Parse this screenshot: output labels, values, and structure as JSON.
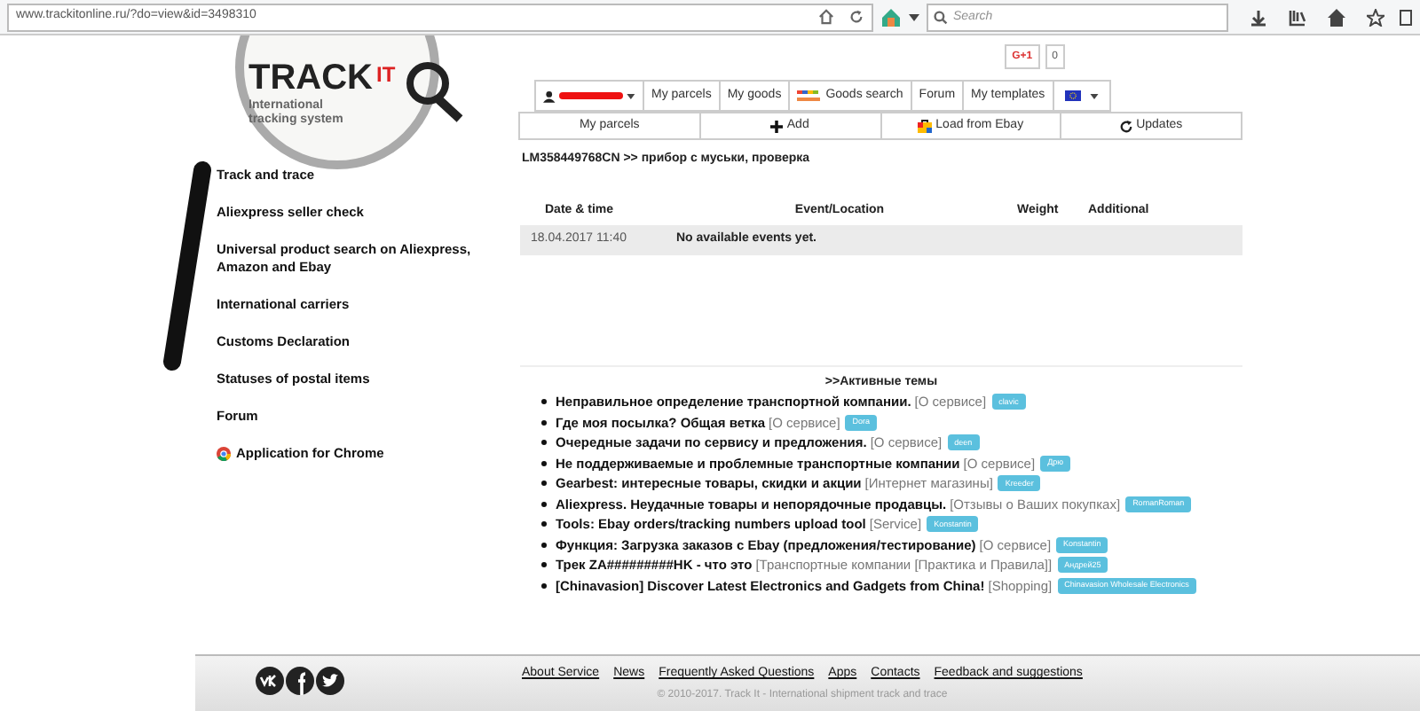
{
  "browser": {
    "url": "www.trackitonline.ru/?do=view&id=3498310",
    "search_placeholder": "Search"
  },
  "logo": {
    "title": "TRACK",
    "badge": "IT",
    "subtitle": "International tracking system"
  },
  "gplus": {
    "label": "G+1",
    "count": "0"
  },
  "nav_tabs": [
    {
      "kind": "user"
    },
    {
      "kind": "text",
      "label": "My parcels"
    },
    {
      "kind": "text",
      "label": "My goods"
    },
    {
      "kind": "shop",
      "label": "Goods search"
    },
    {
      "kind": "text",
      "label": "Forum"
    },
    {
      "kind": "text",
      "label": "My templates"
    },
    {
      "kind": "language"
    }
  ],
  "action_buttons": [
    {
      "kind": "plain",
      "label": "My parcels"
    },
    {
      "kind": "add",
      "label": "Add"
    },
    {
      "kind": "ebay",
      "label": "Load from Ebay"
    },
    {
      "kind": "refresh",
      "label": "Updates"
    }
  ],
  "sidebar": {
    "items": [
      {
        "kind": "text",
        "label": "Track and trace"
      },
      {
        "kind": "text",
        "label": "Aliexpress seller check"
      },
      {
        "kind": "text",
        "label": "Universal product search on Aliexpress, Amazon and Ebay"
      },
      {
        "kind": "text",
        "label": "International carriers"
      },
      {
        "kind": "text",
        "label": "Customs Declaration"
      },
      {
        "kind": "text",
        "label": "Statuses of postal items"
      },
      {
        "kind": "text",
        "label": "Forum"
      },
      {
        "kind": "chrome",
        "label": "Application for Chrome"
      }
    ]
  },
  "parcel_title": "LM358449768CN >> прибор с муськи, проверка",
  "table": {
    "columns": [
      "Date & time",
      "Event/Location",
      "Weight",
      "Additional"
    ],
    "rows": [
      {
        "cells": [
          "18.04.2017 11:40",
          "No available events yet.",
          "",
          ""
        ]
      }
    ]
  },
  "topics": {
    "heading": ">>Активные темы",
    "items": [
      {
        "title": "Неправильное определение транспортной компании.",
        "category": "[О сервисе]",
        "author": "clavic"
      },
      {
        "title": "Где моя посылка? Общая ветка",
        "category": "[О сервисе]",
        "author": "Dora"
      },
      {
        "title": "Очередные задачи по сервису и предложения.",
        "category": "[О сервисе]",
        "author": "deen"
      },
      {
        "title": "Не поддерживаемые и проблемные транспортные компании",
        "category": "[О сервисе]",
        "author": "Дрю"
      },
      {
        "title": "Gearbest: интересные товары, скидки и акции",
        "category": "[Интернет магазины]",
        "author": "Kreeder"
      },
      {
        "title": "Aliexpress. Неудачные товары и непорядочные продавцы.",
        "category": "[Отзывы о Ваших покупках]",
        "author": "RomanRoman"
      },
      {
        "title": "Tools: Ebay orders/tracking numbers upload tool",
        "category": "[Service]",
        "author": "Konstantin"
      },
      {
        "title": "Функция: Загрузка заказов с Ebay (предложения/тестирование)",
        "category": "[О сервисе]",
        "author": "Konstantin"
      },
      {
        "title": "Трек ZA#########HK - что это",
        "category": "[Транспортные компании [Практика и Правила]]",
        "author": "Андрей25"
      },
      {
        "title": "[Chinavasion] Discover Latest Electronics and Gadgets from China!",
        "category": "[Shopping]",
        "author": "Chinavasion Wholesale Electronics"
      }
    ]
  },
  "footer": {
    "links": [
      "About Service",
      "News",
      "Frequently Asked Questions",
      "Apps",
      "Contacts",
      "Feedback and suggestions"
    ],
    "copyright": "© 2010-2017. Track It - International shipment track and trace"
  }
}
